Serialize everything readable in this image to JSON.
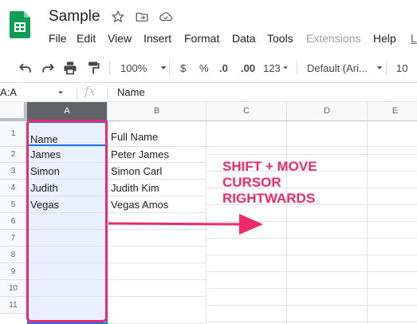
{
  "app": {
    "title": "Sample",
    "menu": [
      "File",
      "Edit",
      "View",
      "Insert",
      "Format",
      "Data",
      "Tools",
      "Extensions",
      "Help",
      "L"
    ]
  },
  "toolbar": {
    "zoom": "100%",
    "currency": "$",
    "percent": "%",
    "decrease_decimals": ".0",
    "increase_decimals": ".00",
    "more_formats": "123",
    "font": "Default (Ari...",
    "font_size": "10"
  },
  "formula_bar": {
    "name_box": "A:A",
    "fx": "fx",
    "value": "Name"
  },
  "grid": {
    "columns": [
      "A",
      "B",
      "C",
      "D",
      "E"
    ],
    "rows": [
      "1",
      "2",
      "3",
      "4",
      "5",
      "6",
      "7",
      "8",
      "9",
      "10",
      "11"
    ],
    "cells": {
      "A1": "Name",
      "B1": "Full Name",
      "A2": "James",
      "B2": "Peter James",
      "A3": "Simon",
      "B3": "Simon Carl",
      "A4": "Judith",
      "B4": "Judith Kim",
      "A5": "Vegas",
      "B5": "Vegas Amos"
    },
    "selected_column": "A"
  },
  "annotation": {
    "lines": [
      "SHIFT + MOVE",
      "CURSOR",
      "RIGHTWARDS"
    ],
    "color": "#ee2a6b"
  },
  "colors": {
    "selection_fill": "#e8f0fe",
    "selection_border": "#1a73e8",
    "sheets_green": "#0f9d58"
  }
}
